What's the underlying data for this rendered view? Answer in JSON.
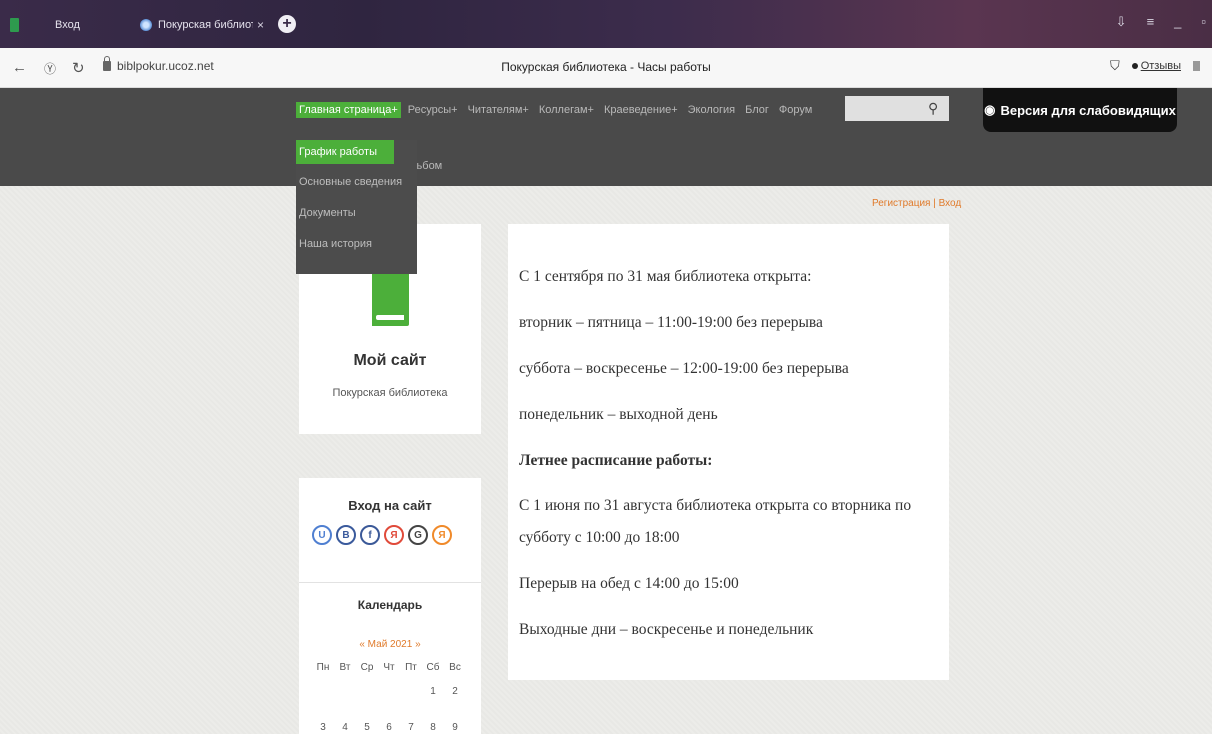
{
  "browser": {
    "tabs": [
      {
        "label": "Вход"
      },
      {
        "label": "Покурская библиотека"
      }
    ],
    "url_host": "biblpokur.ucoz.net",
    "page_title": "Покурская библиотека - Часы работы",
    "reviews_label": "Отзывы"
  },
  "header": {
    "menu": [
      "Главная страница+",
      "Ресурсы+",
      "Читателям+",
      "Коллегам+",
      "Краеведение+",
      "Экология",
      "Блог",
      "Форум"
    ],
    "menu_row2": "альбом",
    "dropdown": [
      "График работы",
      "Основные сведения",
      "Документы",
      "Наша история"
    ],
    "vi_button": "Версия для слабовидящих"
  },
  "auth_links": "Регистрация | Вход",
  "sidebar": {
    "site_name": "Мой сайт",
    "site_sub": "Покурская библиотека",
    "login_title": "Вход на сайт",
    "social": [
      "U",
      "B",
      "f",
      "Я",
      "G",
      "Я"
    ],
    "calendar_title": "Календарь",
    "calendar_month": "« Май 2021 »",
    "weekdays": [
      "Пн",
      "Вт",
      "Ср",
      "Чт",
      "Пт",
      "Сб",
      "Вс"
    ],
    "week1": [
      "",
      "",
      "",
      "",
      "",
      "1",
      "2"
    ],
    "week2": [
      "3",
      "4",
      "5",
      "6",
      "7",
      "8",
      "9"
    ]
  },
  "main": {
    "line1": "С 1 сентября по 31 мая библиотека открыта:",
    "line2": "вторник – пятница – 11:00-19:00 без перерыва",
    "line3": "суббота – воскресенье – 12:00-19:00 без перерыва",
    "line4": "понедельник – выходной день",
    "line5": "Летнее расписание работы:",
    "line6a": "С 1 июня по 31 августа библиотека открыта со вторника по",
    "line6b": "субботу с 10:00 до 18:00",
    "line7": "Перерыв на обед с 14:00 до 15:00",
    "line8": "Выходные дни – воскресенье и понедельник"
  },
  "colors": {
    "accent": "#4caf3a",
    "link": "#e07a2a",
    "header_bg": "#4a4a4a"
  }
}
